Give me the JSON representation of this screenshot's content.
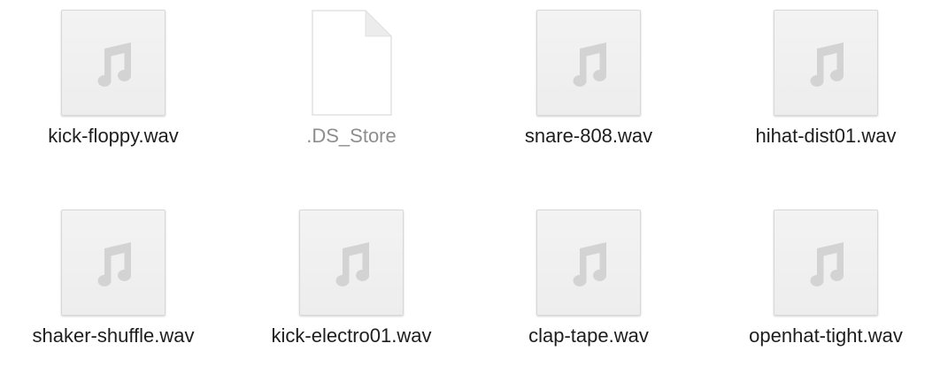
{
  "files": [
    {
      "name": "kick-floppy.wav",
      "icon": "music-note-icon",
      "kind": "audio"
    },
    {
      "name": ".DS_Store",
      "icon": "document-icon",
      "kind": "document",
      "hidden": true
    },
    {
      "name": "snare-808.wav",
      "icon": "music-note-icon",
      "kind": "audio"
    },
    {
      "name": "hihat-dist01.wav",
      "icon": "music-note-icon",
      "kind": "audio"
    },
    {
      "name": "shaker-shuffle.wav",
      "icon": "music-note-icon",
      "kind": "audio"
    },
    {
      "name": "kick-electro01.wav",
      "icon": "music-note-icon",
      "kind": "audio"
    },
    {
      "name": "clap-tape.wav",
      "icon": "music-note-icon",
      "kind": "audio"
    },
    {
      "name": "openhat-tight.wav",
      "icon": "music-note-icon",
      "kind": "audio"
    }
  ],
  "colors": {
    "label": "#1e1e1e",
    "hidden_label": "#8e8e8e",
    "thumb_bg": "#f0f0f0",
    "note_glyph": "#d3d3d3"
  }
}
